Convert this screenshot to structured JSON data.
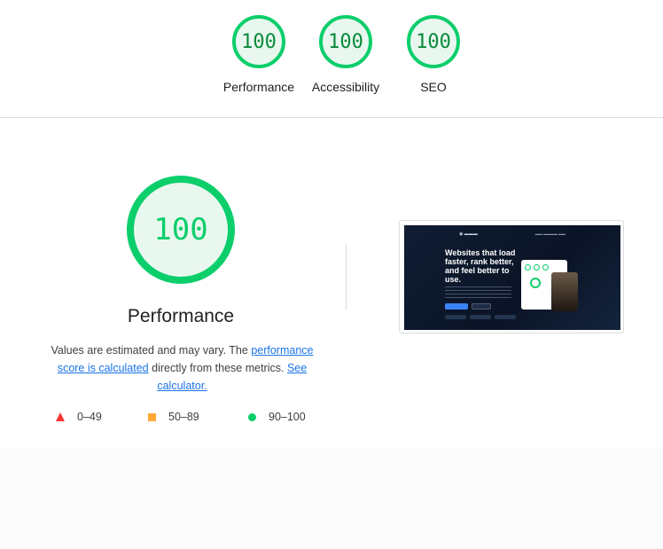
{
  "summary": {
    "gauges": [
      {
        "score": "100",
        "label": "Performance"
      },
      {
        "score": "100",
        "label": "Accessibility"
      },
      {
        "score": "100",
        "label": "SEO"
      }
    ]
  },
  "performance": {
    "score": "100",
    "title": "Performance",
    "desc_prefix": "Values are estimated and may vary. The ",
    "link_score": "performance score is calculated",
    "desc_middle": " directly from these metrics. ",
    "link_calc": "See calculator."
  },
  "legend": [
    {
      "icon": "triangle-icon",
      "range": "0–49",
      "color": "#ff3333"
    },
    {
      "icon": "square-icon",
      "range": "50–89",
      "color": "#ffaa33"
    },
    {
      "icon": "circle-icon",
      "range": "90–100",
      "color": "#0cce6b"
    }
  ],
  "screenshot": {
    "headline": "Websites that load faster, rank better, and feel better to use."
  },
  "colors": {
    "pass": "#0cce6b",
    "link": "#1a73e8"
  }
}
